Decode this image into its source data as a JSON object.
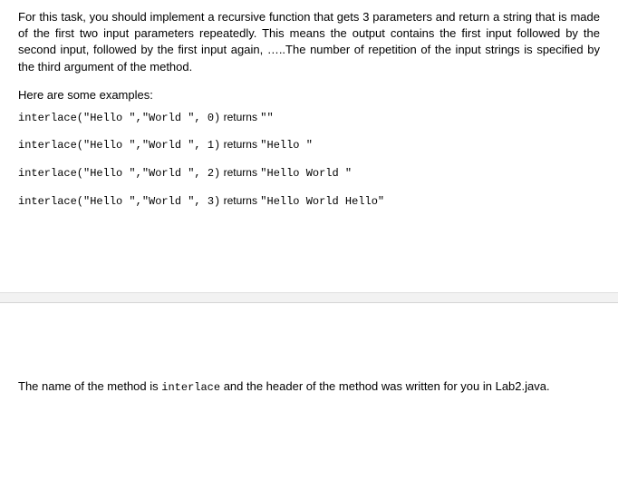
{
  "intro": "For this task, you should implement a recursive function that gets 3 parameters and return a string that is made of the first two input parameters repeatedly. This means the output contains the first input followed by the second input, followed by the first input again, …..The number of repetition of the input strings is specified by the third argument of the method.",
  "examples_heading": "Here are some examples:",
  "examples": [
    {
      "call": "interlace(\"Hello \",\"World \", 0)",
      "returns_label": "returns",
      "result": "\"\""
    },
    {
      "call": "interlace(\"Hello \",\"World \", 1)",
      "returns_label": "returns",
      "result": "\"Hello \""
    },
    {
      "call": "interlace(\"Hello \",\"World \", 2)",
      "returns_label": "returns",
      "result": "\"Hello World \""
    },
    {
      "call": "interlace(\"Hello \",\"World \", 3)",
      "returns_label": "returns",
      "result": "\"Hello World Hello\""
    }
  ],
  "footer": {
    "pre": "The name of the method is ",
    "code": "interlace",
    "post": " and the header of the method was written for you in Lab2.java."
  }
}
